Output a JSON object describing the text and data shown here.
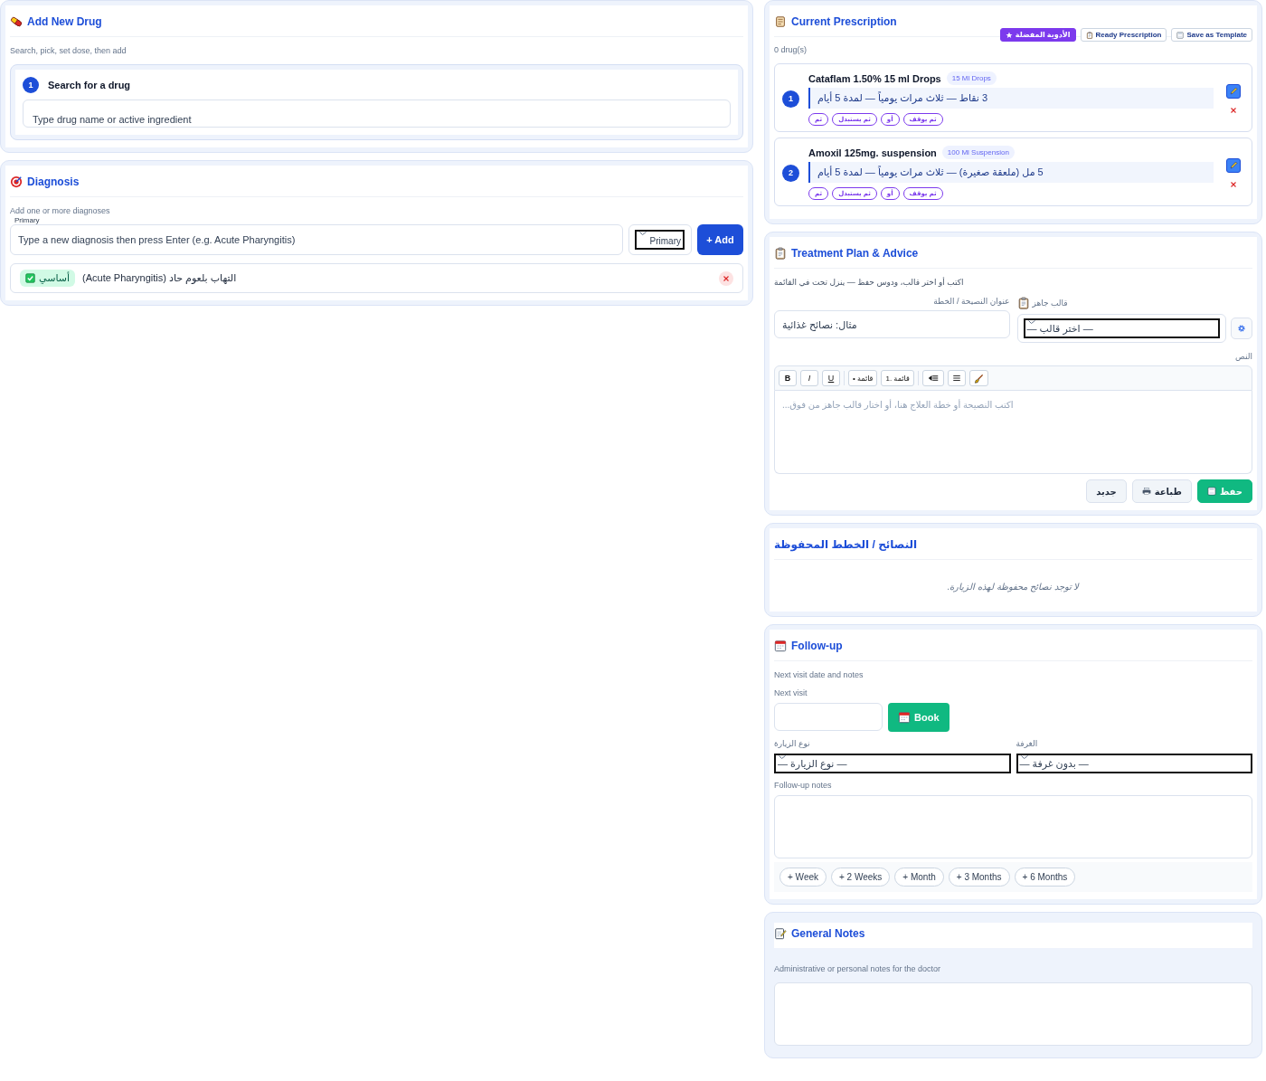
{
  "add_drug": {
    "title": "Add New Drug",
    "subtitle": "Search, pick, set dose, then add",
    "step": {
      "number": "1",
      "title": "Search for a drug"
    },
    "search": {
      "placeholder": "Type drug name or active ingredient"
    }
  },
  "diagnosis": {
    "title": "Diagnosis",
    "subtitle": "Add one or more diagnoses",
    "input": {
      "label": "Primary",
      "placeholder": "Type a new diagnosis then press Enter (e.g. Acute Pharyngitis)"
    },
    "type_select": {
      "value": "Primary"
    },
    "add_button": "+ Add",
    "items": [
      {
        "badge": "أساسي",
        "checked": true,
        "name": "التهاب بلعوم حاد (Acute Pharyngitis)"
      }
    ]
  },
  "prescription": {
    "title": "Current Prescription",
    "actions": [
      {
        "kind": "template",
        "label": "Save as Template"
      },
      {
        "kind": "ready",
        "label": "Ready Prescription"
      },
      {
        "kind": "favorites",
        "label": "الأدوية المفضلة"
      }
    ],
    "count": "0 drug(s)",
    "drugs": [
      {
        "number": "1",
        "name": "Cataflam 1.50% 15 ml Drops",
        "package": "15 Ml Drops",
        "dose": "3 نقاط — ثلاث مرات يومياً — لمدة 5 أيام",
        "tags": [
          "ثم يوقف",
          "أو",
          "ثم يستبدل",
          "ثم"
        ]
      },
      {
        "number": "2",
        "name": "Amoxil 125mg. suspension",
        "package": "100 Ml Suspension",
        "dose": "5 مل (ملعقة صغيرة) — ثلاث مرات يومياً — لمدة 5 أيام",
        "tags": [
          "ثم يوقف",
          "أو",
          "ثم يستبدل",
          "ثم"
        ]
      }
    ]
  },
  "treatment": {
    "title": "Treatment Plan & Advice",
    "hint": "اكتب أو اختر قالب، ودوس حفظ — ينزل تحت في القائمة",
    "title_field": {
      "label": "عنوان النصيحة / الخطة",
      "placeholder": "مثال: نصائح غذائية"
    },
    "template_field": {
      "label": "قالب جاهز",
      "value": "— اختر قالب —"
    },
    "body_label": "النص",
    "toolbar": [
      {
        "kind": "clear"
      },
      {
        "kind": "align"
      },
      {
        "kind": "rtl"
      },
      {
        "kind": "numbers",
        "label": "1. قائمة"
      },
      {
        "kind": "bullets",
        "label": "• قائمة"
      },
      {
        "kind": "underline",
        "label": "U"
      },
      {
        "kind": "italic",
        "label": "I"
      },
      {
        "kind": "bold",
        "label": "B"
      }
    ],
    "editor": {
      "placeholder": "اكتب النصيحة أو خطة العلاج هنا، أو اختار قالب جاهز من فوق..."
    },
    "buttons": [
      {
        "kind": "save",
        "label": "حفظ"
      },
      {
        "kind": "print",
        "label": "طباعة"
      },
      {
        "kind": "new",
        "label": "جديد"
      }
    ]
  },
  "saved": {
    "title": "النصائح / الخطط المحفوظة",
    "empty": "لا توجد نصائح محفوظة لهذه الزيارة."
  },
  "followup": {
    "title": "Follow-up",
    "subtitle": "Next visit date and notes",
    "date_label": "Next visit",
    "book_button": "Book",
    "visit_type": {
      "label": "نوع الزيارة",
      "value": "— نوع الزيارة —"
    },
    "room": {
      "label": "الغرفة",
      "value": "— بدون غرفة —"
    },
    "notes_label": "Follow-up notes",
    "quick": [
      "+ 6 Months",
      "+ 3 Months",
      "+ Month",
      "+ 2 Weeks",
      "+ Week"
    ]
  },
  "general_notes": {
    "title": "General Notes",
    "subtitle": "Administrative or personal notes for the doctor"
  }
}
